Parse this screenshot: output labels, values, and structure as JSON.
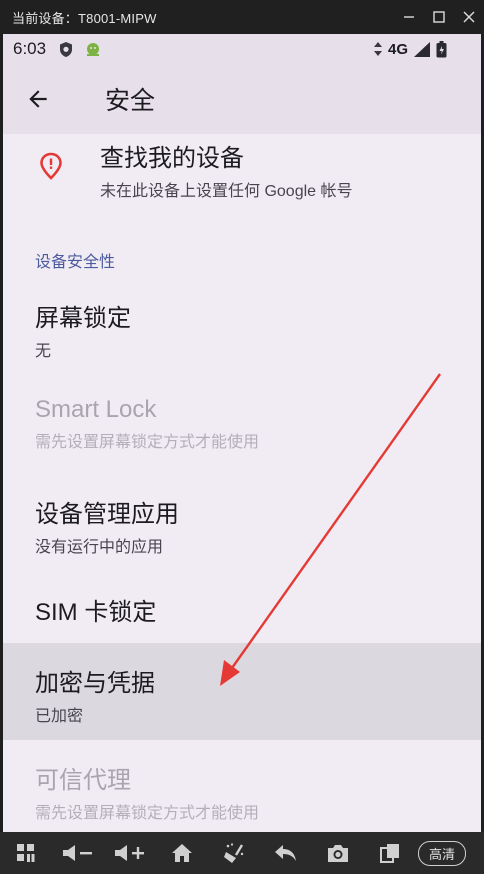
{
  "window": {
    "title": "当前设备：T8001-MIPW",
    "controls": [
      "minimize",
      "maximize",
      "close"
    ]
  },
  "status_bar": {
    "time": "6:03",
    "network": "4G",
    "left_icons": [
      "shield-icon",
      "android-icon"
    ],
    "right_icons": [
      "data-arrows-icon",
      "signal-icon",
      "battery-icon"
    ]
  },
  "app_bar": {
    "title": "安全",
    "back_icon": "arrow-left-icon"
  },
  "items": [
    {
      "title": "查找我的设备",
      "summary": "未在此设备上设置任何 Google 帐号",
      "icon": "location-alert-icon",
      "enabled": true
    },
    {
      "section": "设备安全性"
    },
    {
      "title": "屏幕锁定",
      "summary": "无",
      "enabled": true
    },
    {
      "title": "Smart Lock",
      "summary": "需先设置屏幕锁定方式才能使用",
      "enabled": false
    },
    {
      "title": "设备管理应用",
      "summary": "没有运行中的应用",
      "enabled": true
    },
    {
      "title": "SIM 卡锁定",
      "summary": "",
      "enabled": true
    },
    {
      "title": "加密与凭据",
      "summary": "已加密",
      "enabled": true,
      "highlighted": true
    },
    {
      "title": "可信代理",
      "summary": "需先设置屏幕锁定方式才能使用",
      "enabled": false
    }
  ],
  "bottom_bar": {
    "items": [
      "apps-icon",
      "volume-down-icon",
      "volume-up-icon",
      "home-icon",
      "clean-icon",
      "back-icon",
      "screenshot-icon",
      "rotate-icon"
    ],
    "quality_label": "高清"
  },
  "colors": {
    "background": "#f1ecf4",
    "app_bar": "#e7e0ea",
    "section_header": "#4c5a9e",
    "accent_red": "#e53935",
    "highlight_row": "#dcd8df"
  }
}
